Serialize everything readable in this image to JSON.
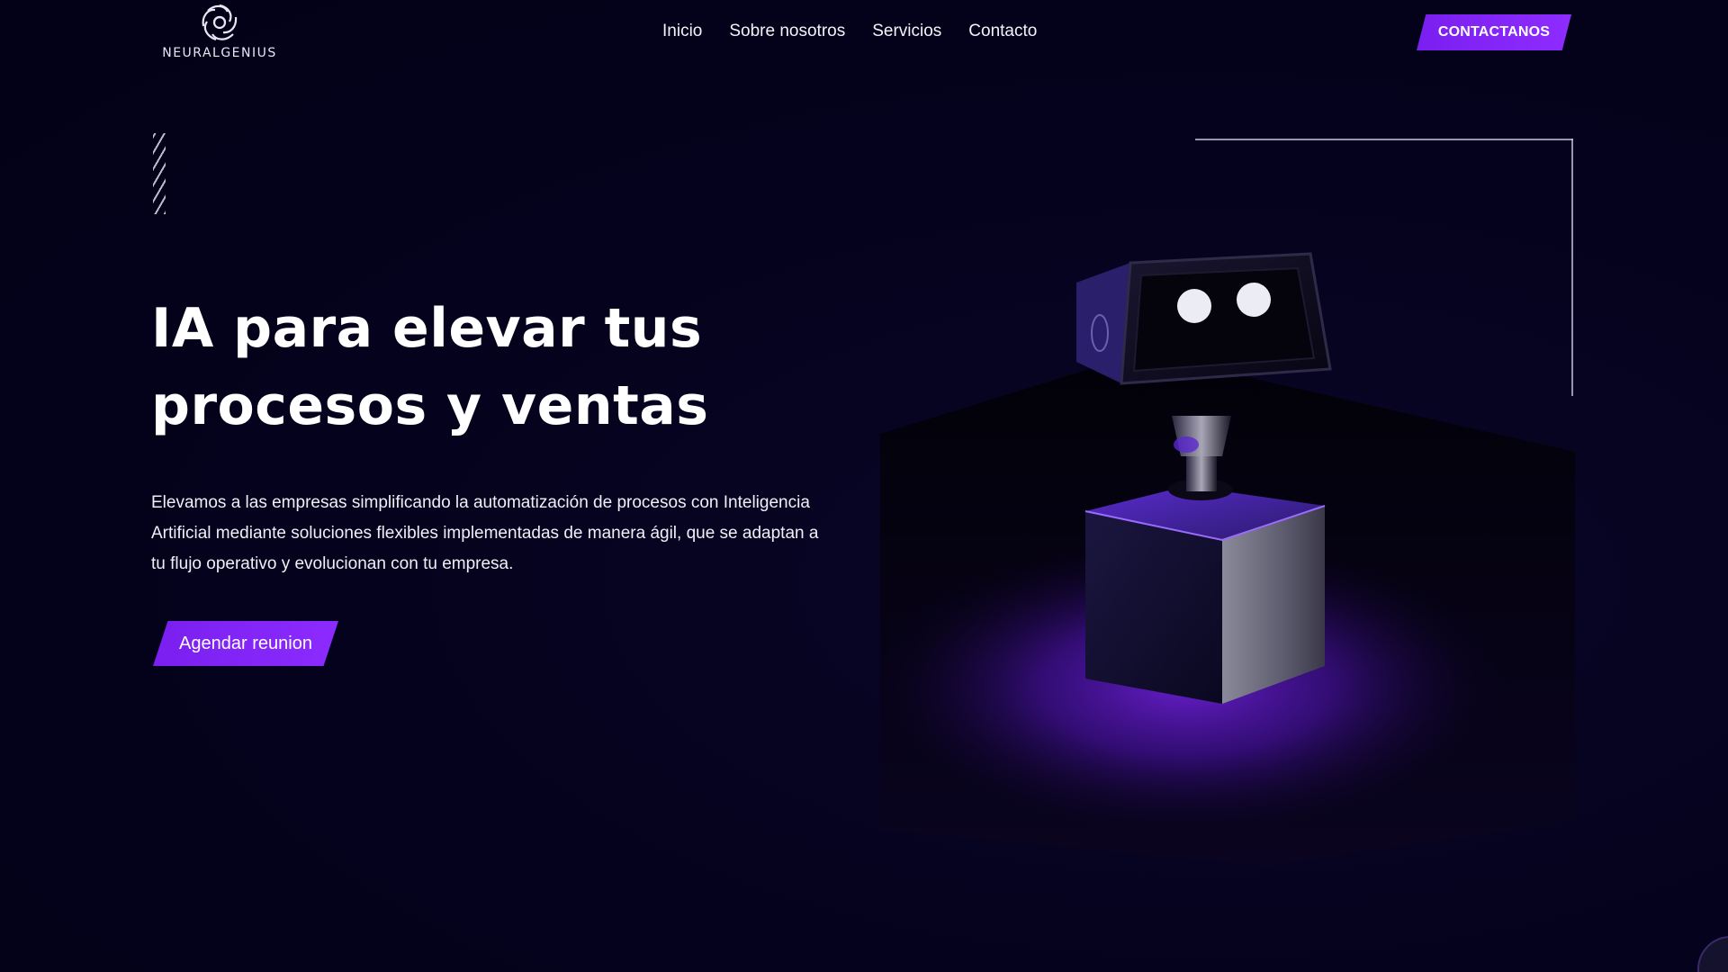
{
  "brand": {
    "name": "NEURALGENIUS",
    "logo_icon": "spiral-knot-icon"
  },
  "nav": {
    "items": [
      {
        "label": "Inicio"
      },
      {
        "label": "Sobre nosotros"
      },
      {
        "label": "Servicios"
      },
      {
        "label": "Contacto"
      }
    ],
    "cta_label": "CONTACTANOS"
  },
  "hero": {
    "title_line1": "IA para elevar tus",
    "title_line2": "procesos y ventas",
    "description": "Elevamos a las empresas simplificando la automatización de procesos con Inteligencia Artificial mediante soluciones flexibles implementadas de manera ágil, que se adaptan a tu flujo operativo y evolucionan con tu empresa.",
    "cta_label": "Agendar reunion"
  },
  "colors": {
    "background": "#04021c",
    "accent": "#7a1ff0",
    "glow": "#5a16b8"
  },
  "illustration": {
    "icon": "robot-on-cube-icon"
  },
  "widget": {
    "icon": "chat-bubble-icon"
  }
}
